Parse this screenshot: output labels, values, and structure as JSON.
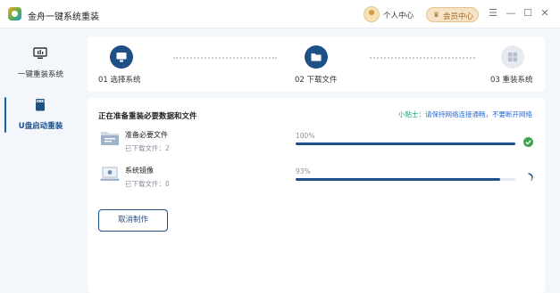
{
  "window": {
    "title": "金舟一键系统重装",
    "user_center": "个人中心",
    "vip_label": "会员中心",
    "controls": [
      "menu-icon",
      "minimize-icon",
      "maximize-icon",
      "close-icon"
    ]
  },
  "sidebar": {
    "items": [
      {
        "label": "一键重装系统",
        "icon": "monitor-icon",
        "active": false
      },
      {
        "label": "U盘启动重装",
        "icon": "usb-drive-icon",
        "active": true
      }
    ]
  },
  "steps": [
    {
      "label": "01 选择系统",
      "icon": "monitor-icon",
      "state": "done"
    },
    {
      "label": "02 下载文件",
      "icon": "folder-icon",
      "state": "done"
    },
    {
      "label": "03 重装系统",
      "icon": "windows-icon",
      "state": "pending"
    }
  ],
  "main": {
    "section_title": "正在准备重装必要数据和文件",
    "tip_prefix": "小贴士：",
    "tip_text": "请保持网络连接通畅，不要断开网络",
    "files": [
      {
        "name": "准备必要文件",
        "sub": "已下载文件：2",
        "percent_label": "100%",
        "progress": 1.0,
        "status": "done",
        "icon": "folder-icon"
      },
      {
        "name": "系统镜像",
        "sub": "已下载文件：0",
        "percent_label": "93%",
        "progress": 0.93,
        "status": "loading",
        "icon": "disk-image-icon"
      }
    ],
    "cancel_label": "取消制作"
  },
  "colors": {
    "accent": "#1e4f86",
    "success": "#3fa34d",
    "tip": "#2a6ad1",
    "vip": "#a5672a"
  }
}
